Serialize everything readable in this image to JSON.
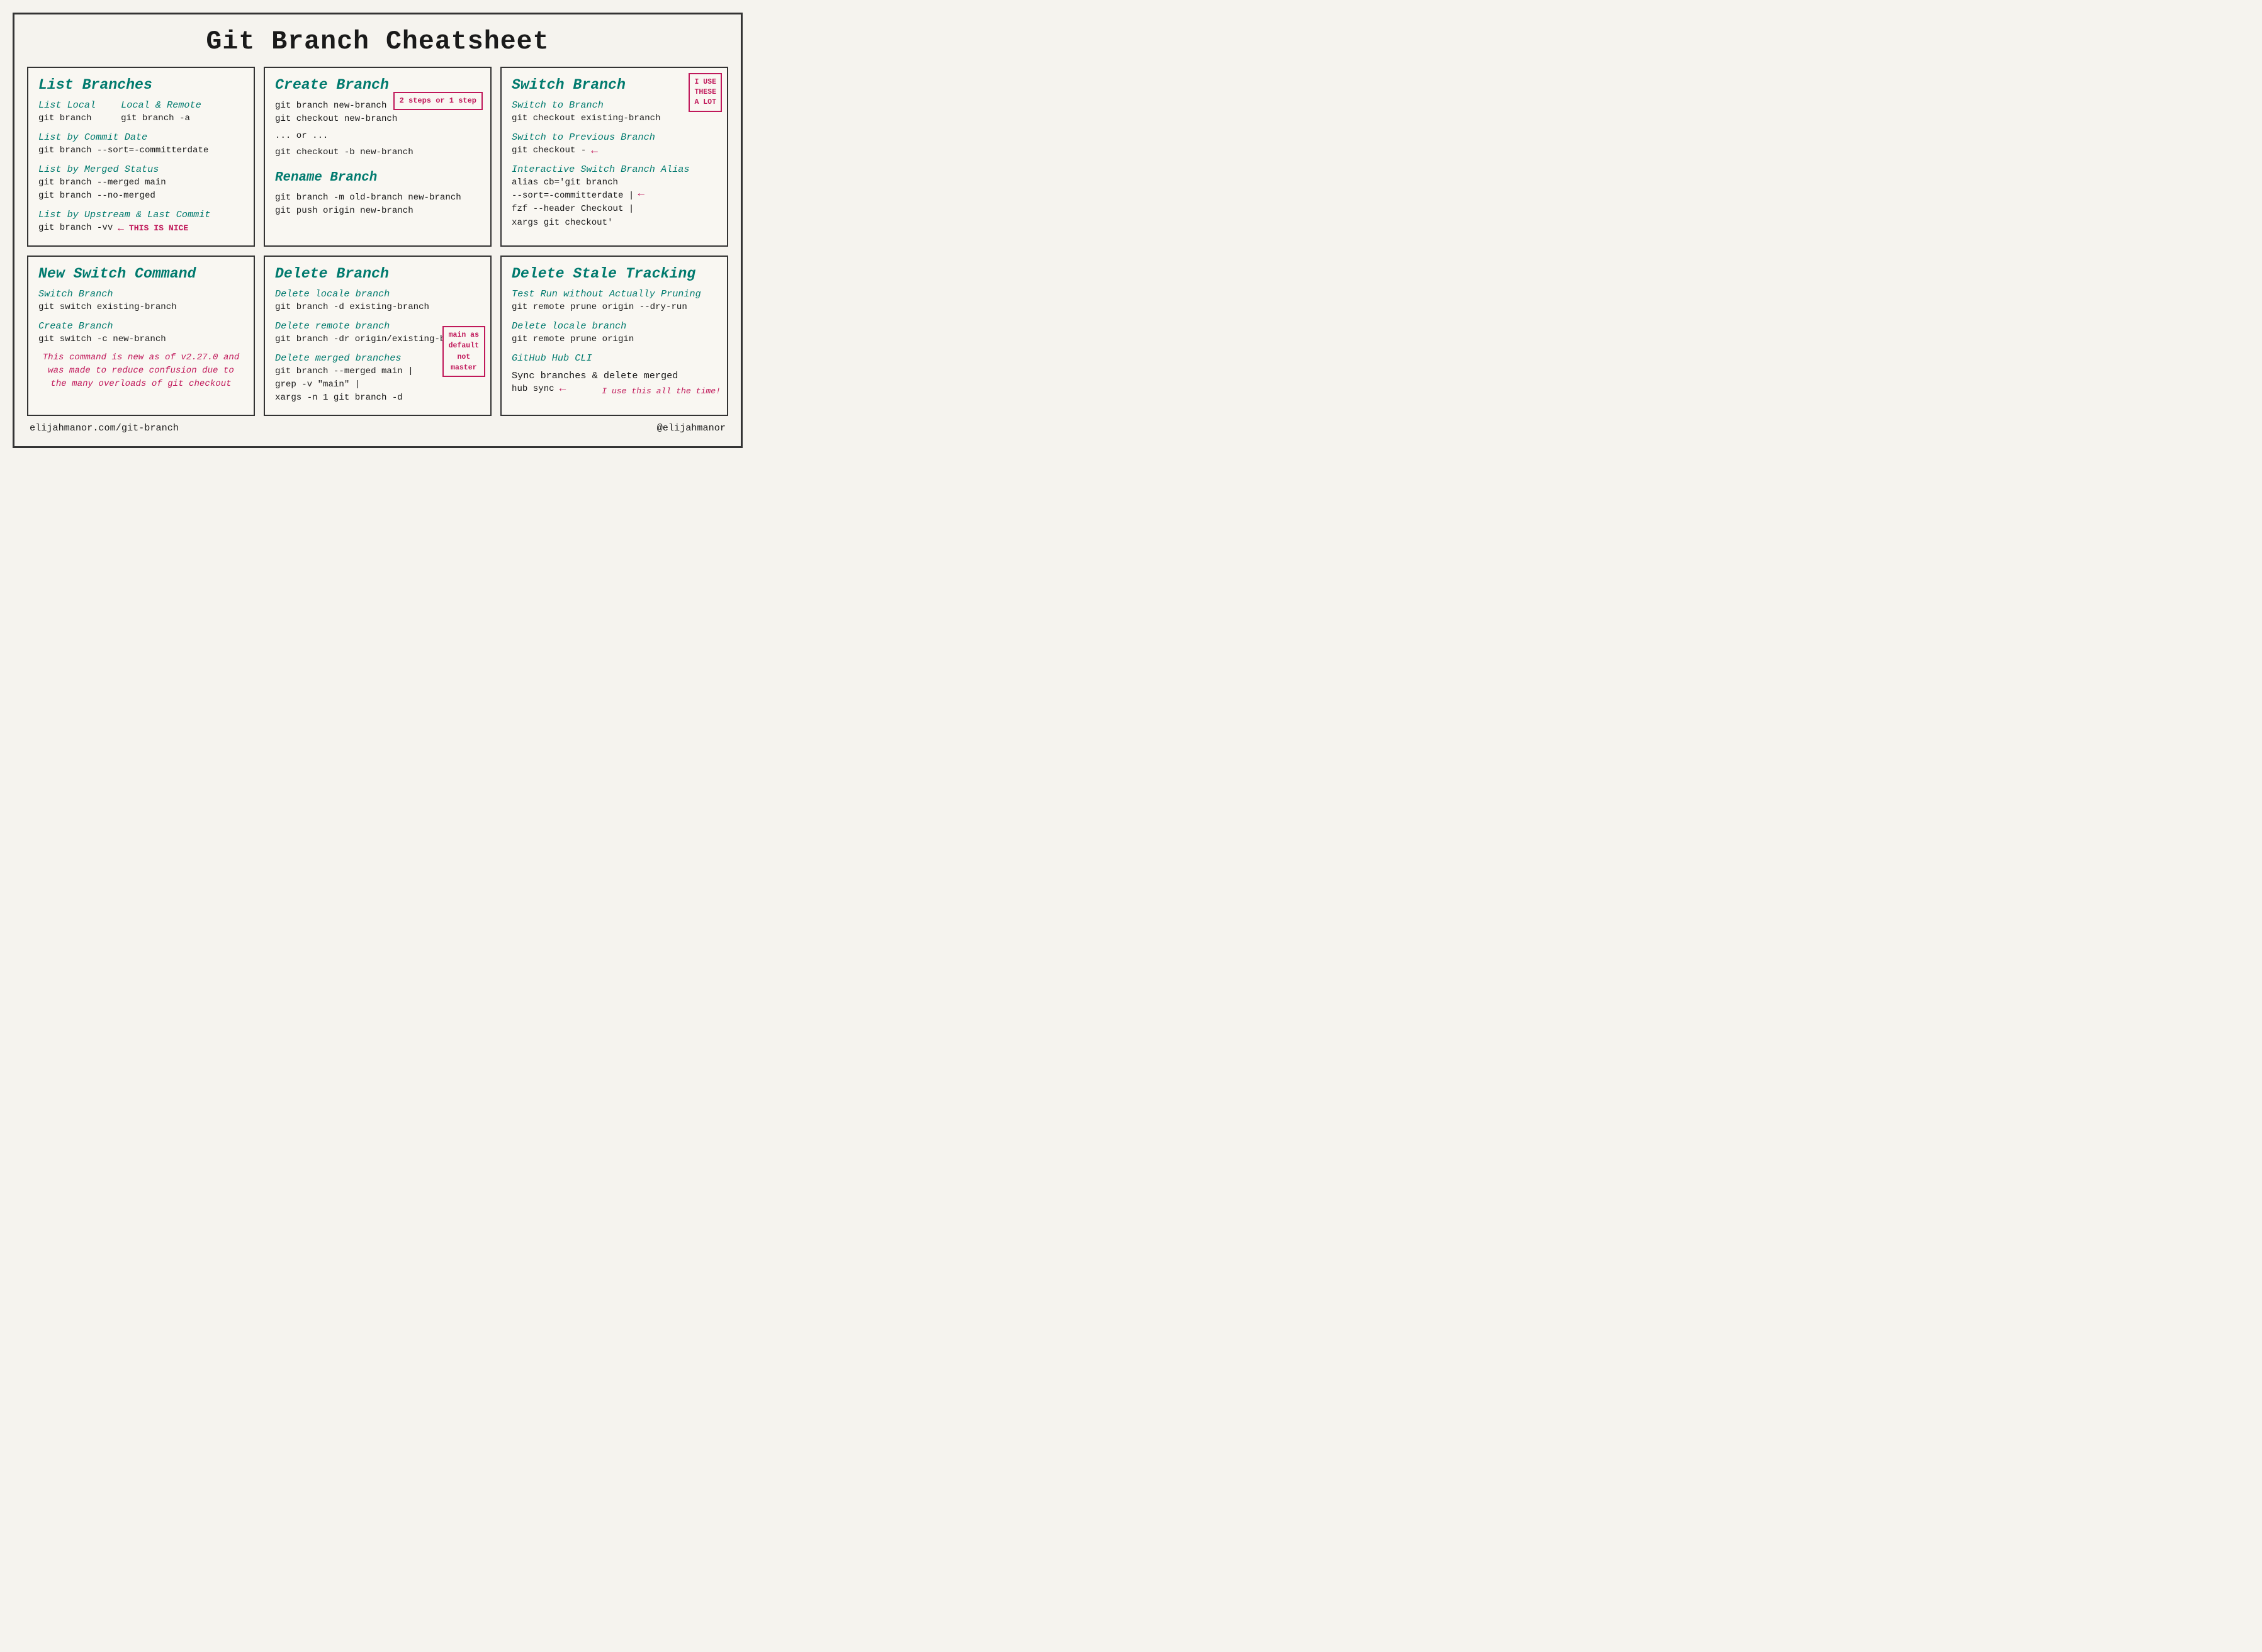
{
  "page": {
    "title": "Git Branch Cheatsheet",
    "footer": {
      "left": "elijahmanor.com/git-branch",
      "right": "@elijahmanor"
    }
  },
  "cards": {
    "list_branches": {
      "title": "List Branches",
      "local_label": "List Local",
      "remote_label": "Local & Remote",
      "local_cmd": "git branch",
      "remote_cmd": "git branch -a",
      "commit_date_label": "List by Commit Date",
      "commit_date_cmd": "git branch --sort=-committerdate",
      "merged_label": "List by Merged Status",
      "merged_cmd1": "git branch --merged main",
      "merged_cmd2": "git branch --no-merged",
      "upstream_label": "List by Upstream & Last Commit",
      "upstream_cmd": "git branch -vv",
      "annotation": "THIS IS NICE"
    },
    "create_branch": {
      "title": "Create Branch",
      "cmd1": "git branch new-branch",
      "cmd2": "git checkout new-branch",
      "or_text": "... or ...",
      "cmd3": "git checkout -b new-branch",
      "steps_annotation": "2 steps\nor\n1 step",
      "rename_title": "Rename Branch",
      "rename_cmd1": "git branch -m old-branch new-branch",
      "rename_cmd2": "git push origin new-branch"
    },
    "switch_branch": {
      "title": "Switch Branch",
      "use_these": "I USE\nTHESE\nA LOT",
      "switch_label": "Switch to Branch",
      "switch_cmd": "git checkout existing-branch",
      "prev_label": "Switch to Previous Branch",
      "prev_cmd": "git checkout -",
      "alias_label": "Interactive Switch Branch Alias",
      "alias_cmd1": "alias cb='git branch",
      "alias_cmd2": "--sort=-committerdate |",
      "alias_cmd3": "fzf --header Checkout |",
      "alias_cmd4": "xargs git checkout'"
    },
    "new_switch": {
      "title": "New Switch Command",
      "switch_label": "Switch Branch",
      "switch_cmd": "git switch existing-branch",
      "create_label": "Create Branch",
      "create_cmd": "git switch -c new-branch",
      "note": "This command is new as of\nv2.27.0 and was made to reduce\nconfusion due to the many\noverloads of git checkout"
    },
    "delete_branch": {
      "title": "Delete Branch",
      "local_label": "Delete locale branch",
      "local_cmd": "git branch -d existing-branch",
      "remote_label": "Delete remote branch",
      "remote_cmd": "git branch -dr origin/existing-branch",
      "merged_label": "Delete merged branches",
      "merged_cmd1": "git branch --merged main |",
      "merged_cmd2": "grep -v \"main\" |",
      "merged_cmd3": "xargs -n 1 git branch -d",
      "master_box": "main as\ndefault\nnot\nmaster"
    },
    "delete_stale": {
      "title": "Delete Stale Tracking",
      "dry_label": "Test Run without Actually Pruning",
      "dry_cmd": "git remote prune origin --dry-run",
      "local_label": "Delete locale branch",
      "local_cmd": "git remote prune origin",
      "hub_label": "GitHub Hub CLI",
      "sync_label": "Sync branches & delete merged",
      "sync_cmd": "hub sync",
      "hub_note": "I use this\nall the time!"
    }
  }
}
